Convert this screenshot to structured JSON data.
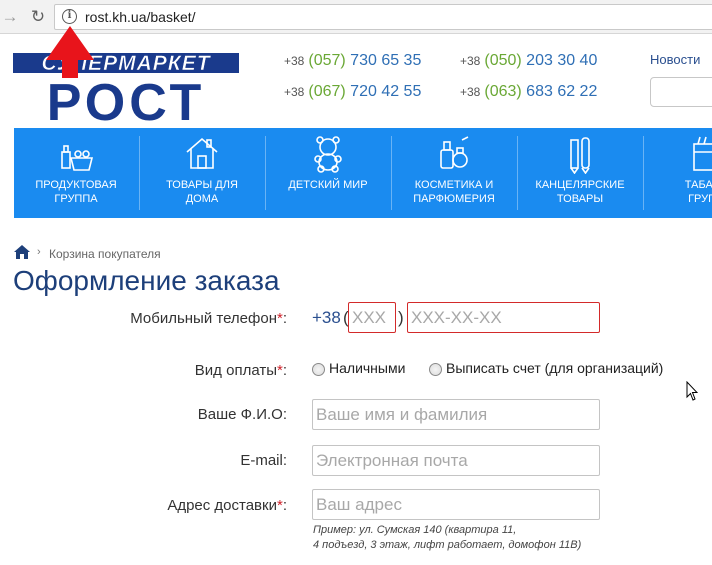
{
  "browser": {
    "url": "rost.kh.ua/basket/"
  },
  "header": {
    "logo_top": "СУПЕРМАРКЕТ",
    "logo_bottom": "РОСТ",
    "phones": [
      {
        "cc": "+38",
        "op": "(057)",
        "num": "730 65 35"
      },
      {
        "cc": "+38",
        "op": "(050)",
        "num": "203 30 40"
      },
      {
        "cc": "+38",
        "op": "(067)",
        "num": "720 42 55"
      },
      {
        "cc": "+38",
        "op": "(063)",
        "num": "683 62 22"
      }
    ],
    "news_label": "Новости"
  },
  "categories": [
    {
      "line1": "ПРОДУКТОВАЯ",
      "line2": "ГРУППА",
      "icon": "grocery-basket-icon"
    },
    {
      "line1": "ТОВАРЫ ДЛЯ",
      "line2": "ДОМА",
      "icon": "house-icon"
    },
    {
      "line1": "ДЕТСКИЙ МИР",
      "line2": "",
      "icon": "teddy-bear-icon"
    },
    {
      "line1": "КОСМЕТИКА И",
      "line2": "ПАРФЮМЕРИЯ",
      "icon": "perfume-icon"
    },
    {
      "line1": "КАНЦЕЛЯРСКИЕ",
      "line2": "ТОВАРЫ",
      "icon": "pencils-icon"
    },
    {
      "line1": "ТАБАЧН",
      "line2": "ГРУПП",
      "icon": "cigarettes-icon"
    }
  ],
  "breadcrumb": {
    "current": "Корзина покупателя"
  },
  "page": {
    "title": "Оформление заказа"
  },
  "form": {
    "phone_label": "Мобильный телефон",
    "phone_prefix": "+38",
    "phone_code_placeholder": "XXX",
    "phone_number_placeholder": "XXX-XX-XX",
    "payment_label": "Вид оплаты",
    "payment_options": [
      "Наличными",
      "Выписать счет (для организаций)"
    ],
    "name_label": "Ваше Ф.И.О:",
    "name_placeholder": "Ваше имя и фамилия",
    "email_label": "E-mail:",
    "email_placeholder": "Электронная почта",
    "address_label": "Адрес доставки",
    "address_placeholder": "Ваш адрес",
    "address_hint_line1": "Пример: ул. Сумская 140 (квартира 11,",
    "address_hint_line2": "4 подъезд, 3 этаж, лифт работает, домофон 11В)",
    "required_mark": "*",
    "colon": ":"
  },
  "colors": {
    "brand_blue": "#1d3f7a",
    "category_bar": "#1a8bf0",
    "phone_blue": "#2f6fb5",
    "operator_green": "#6aa835",
    "error_red": "#d32a2a",
    "annotation_arrow": "#e8141b"
  }
}
